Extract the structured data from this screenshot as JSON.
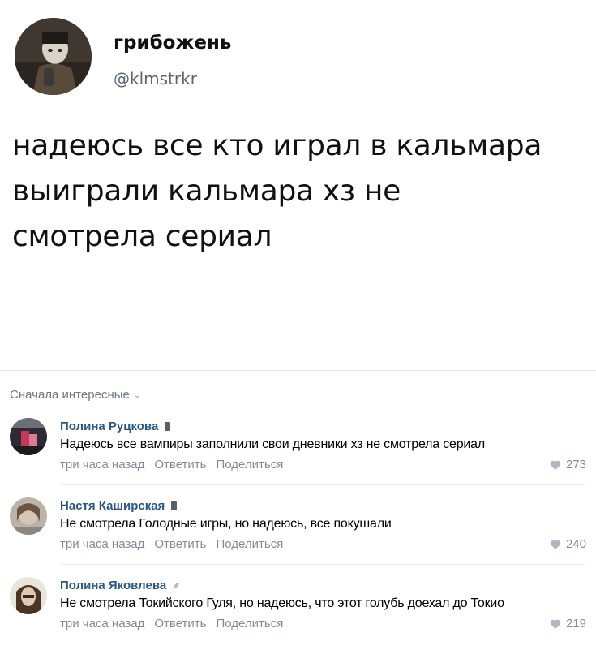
{
  "tweet": {
    "name": "грибожень",
    "handle": "@klmstrkr",
    "lines": [
      "надеюсь все кто играл в кальмара",
      "выиграли кальмара хз не",
      "смотрела сериал"
    ]
  },
  "comments_header": {
    "sort_label": "Сначала интересные"
  },
  "comments": [
    {
      "author": "Полина Руцкова",
      "text": "Надеюсь все вампиры заполнили свои дневники хз не смотрела сериал",
      "time": "три часа назад",
      "reply": "Ответить",
      "share": "Поделиться",
      "likes": "273"
    },
    {
      "author": "Настя Каширская",
      "text": "Не смотрела Голодные игры, но надеюсь, все покушали",
      "time": "три часа назад",
      "reply": "Ответить",
      "share": "Поделиться",
      "likes": "240"
    },
    {
      "author": "Полина Яковлева",
      "text": "Не смотрела Токийского Гуля, но надеюсь, что этот голубь доехал до Токио",
      "time": "три часа назад",
      "reply": "Ответить",
      "share": "Поделиться",
      "likes": "219"
    }
  ],
  "colors": {
    "author_name": "#2a5885",
    "meta_gray": "#818c99",
    "divider": "#e4e6ea"
  },
  "icons": {
    "like": "heart-icon",
    "sort": "chevron-down-icon",
    "badge": "phone-badge-icon"
  }
}
